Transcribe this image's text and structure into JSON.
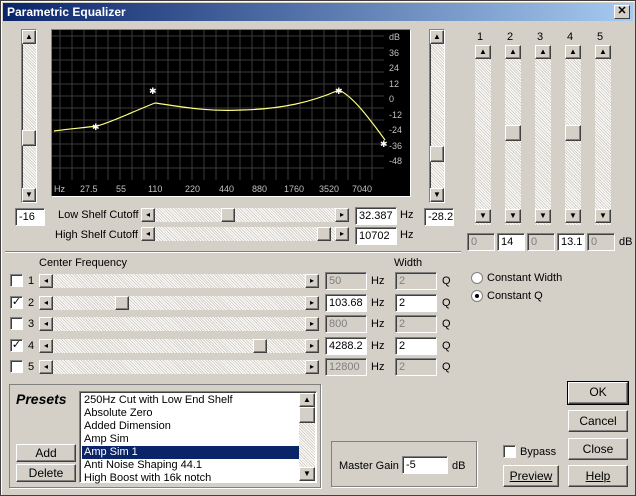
{
  "window": {
    "title": "Parametric Equalizer",
    "close": "✕"
  },
  "graph": {
    "db_labels": [
      "dB",
      "36",
      "24",
      "12",
      "0",
      "-12",
      "-24",
      "-36",
      "-48"
    ],
    "freq_labels": [
      "Hz",
      "27.5",
      "55",
      "110",
      "220",
      "440",
      "880",
      "1760",
      "3520",
      "7040"
    ],
    "curve_color": "#ffff80"
  },
  "left_gain": {
    "value": "-16"
  },
  "right_gain": {
    "value": "-28.2"
  },
  "shelf": {
    "low_label": "Low Shelf Cutoff",
    "low_value": "32.387",
    "low_unit": "Hz",
    "high_label": "High Shelf Cutoff",
    "high_value": "10702",
    "high_unit": "Hz"
  },
  "bands": {
    "headers": [
      "1",
      "2",
      "3",
      "4",
      "5"
    ],
    "gains": [
      "0",
      "14",
      "0",
      "13.1",
      "0"
    ],
    "unit": "dB"
  },
  "center": {
    "title": "Center Frequency",
    "width_title": "Width",
    "hz": "Hz",
    "q": "Q",
    "rows": [
      {
        "n": "1",
        "checked": false,
        "freq": "50",
        "width": "2"
      },
      {
        "n": "2",
        "checked": true,
        "freq": "103.68",
        "width": "2"
      },
      {
        "n": "3",
        "checked": false,
        "freq": "800",
        "width": "2"
      },
      {
        "n": "4",
        "checked": true,
        "freq": "4288.2",
        "width": "2"
      },
      {
        "n": "5",
        "checked": false,
        "freq": "12800",
        "width": "2"
      }
    ]
  },
  "mode": {
    "constant_width": "Constant Width",
    "constant_q": "Constant Q",
    "selected": "constant_q"
  },
  "presets": {
    "title": "Presets",
    "add": "Add",
    "delete": "Delete",
    "items": [
      "250Hz Cut with Low End Shelf",
      "Absolute Zero",
      "Added Dimension",
      "Amp Sim",
      "Amp Sim 1",
      "Anti Noise Shaping 44.1",
      "High Boost with 16k notch"
    ],
    "selected_index": 4
  },
  "master": {
    "label": "Master Gain",
    "value": "-5",
    "unit": "dB"
  },
  "bypass": {
    "label": "Bypass",
    "checked": false
  },
  "buttons": {
    "ok": "OK",
    "cancel": "Cancel",
    "close": "Close",
    "preview": "Preview",
    "help": "Help"
  }
}
